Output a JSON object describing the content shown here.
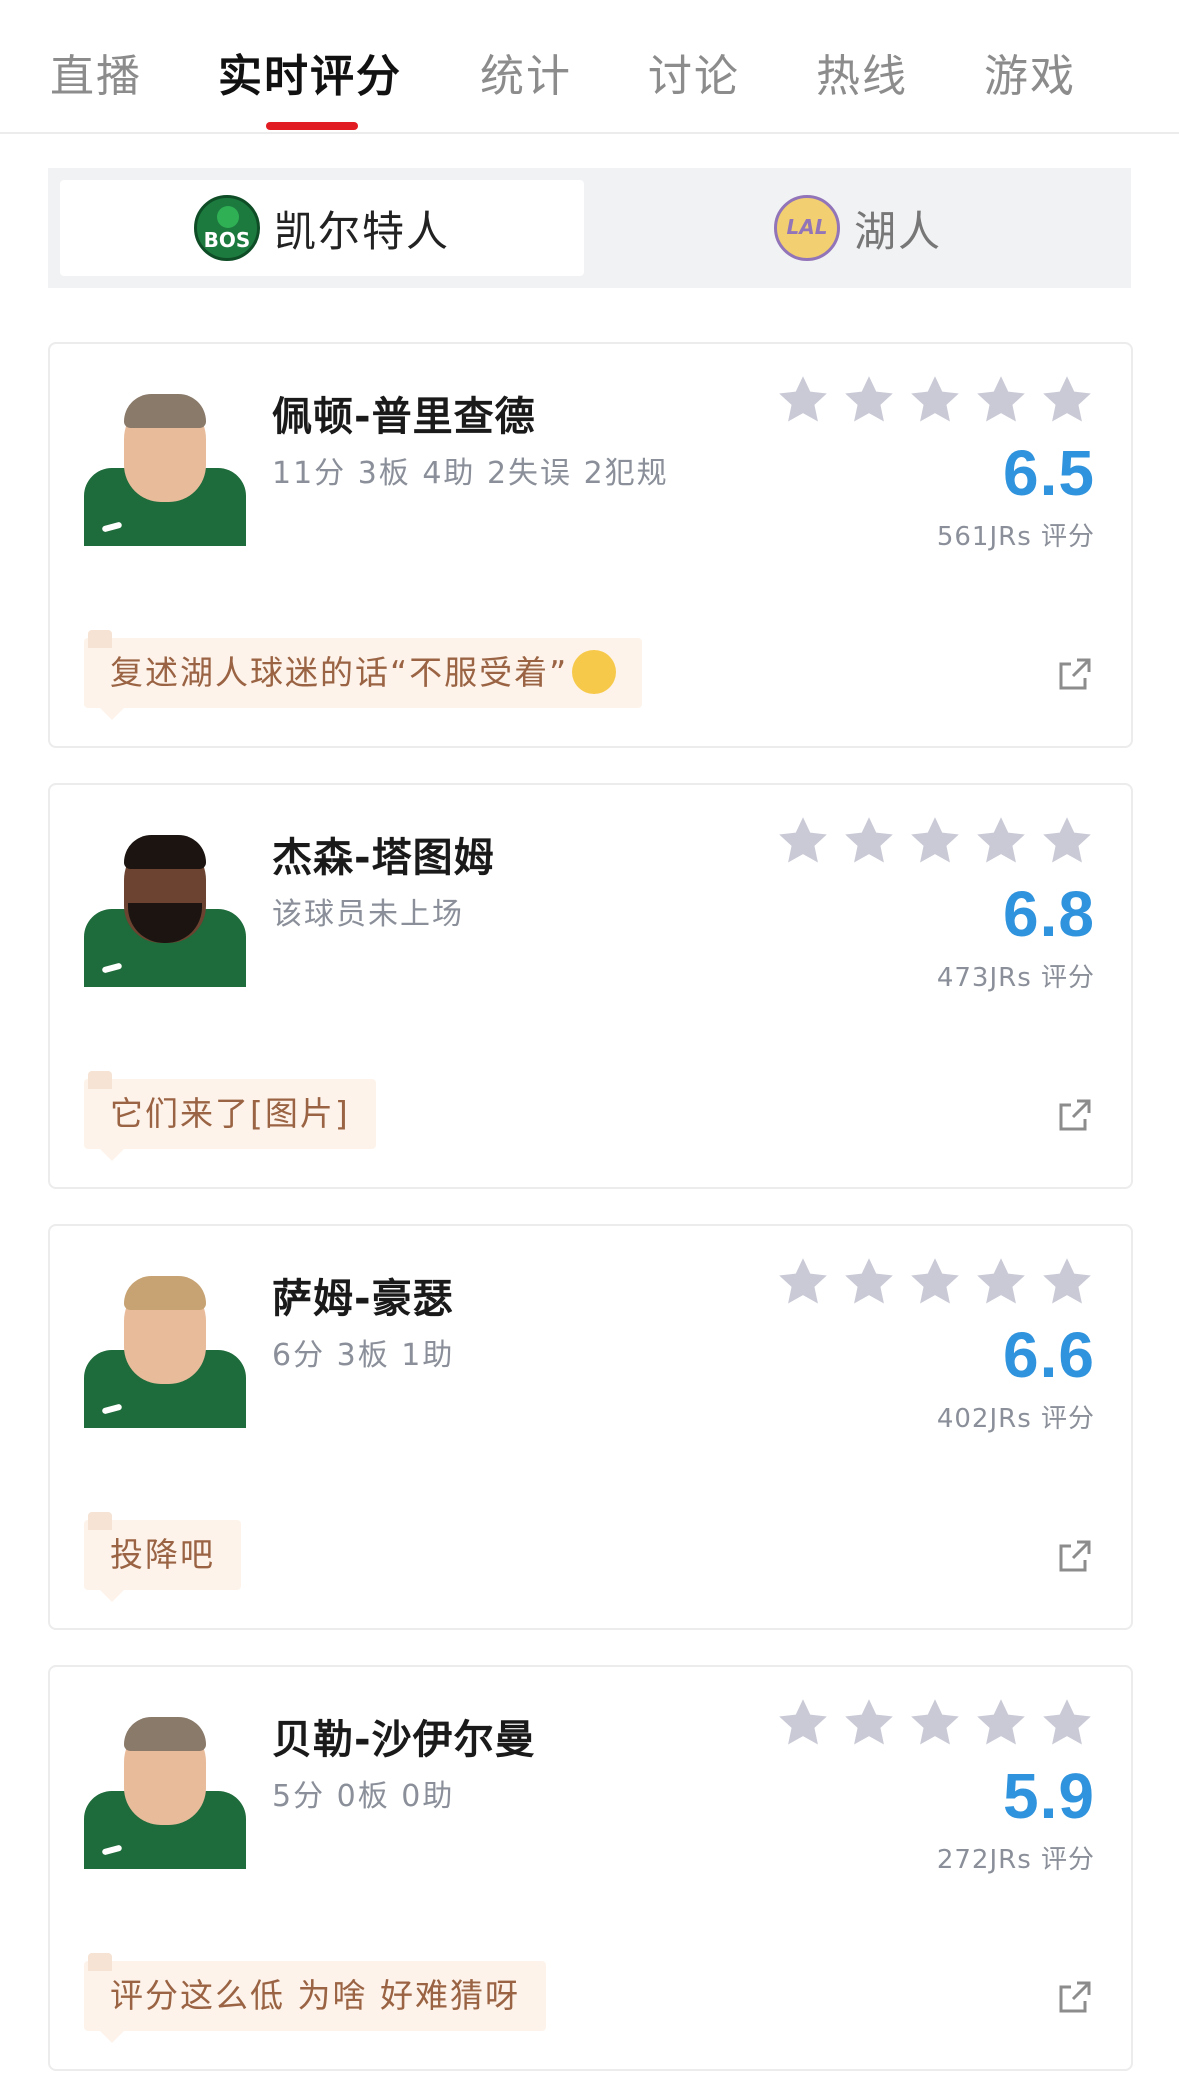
{
  "tabs": [
    {
      "label": "直播"
    },
    {
      "label": "实时评分"
    },
    {
      "label": "统计"
    },
    {
      "label": "讨论"
    },
    {
      "label": "热线"
    },
    {
      "label": "游戏"
    }
  ],
  "active_tab": "实时评分",
  "teams": {
    "home": {
      "name": "凯尔特人",
      "logo_text": "BOS",
      "logo_icon": "celtics-logo"
    },
    "away": {
      "name": "湖人",
      "logo_text": "LAL",
      "logo_icon": "lakers-logo"
    },
    "selected": "凯尔特人"
  },
  "players": [
    {
      "name": "佩顿-普里查德",
      "stats": "11分 3板 4助 2失误 2犯规",
      "score": "6.5",
      "rating_count": "561JRs 评分",
      "comment": "复述湖人球迷的话“不服受着”",
      "comment_emoji": "smirk-emoji"
    },
    {
      "name": "杰森-塔图姆",
      "stats": "该球员未上场",
      "score": "6.8",
      "rating_count": "473JRs 评分",
      "comment": "它们来了[图片]"
    },
    {
      "name": "萨姆-豪瑟",
      "stats": "6分 3板 1助",
      "score": "6.6",
      "rating_count": "402JRs 评分",
      "comment": "投降吧"
    },
    {
      "name": "贝勒-沙伊尔曼",
      "stats": "5分 0板 0助",
      "score": "5.9",
      "rating_count": "272JRs 评分",
      "comment": "评分这么低 为啥 好难猜呀"
    }
  ],
  "colors": {
    "accent_red": "#e21c23",
    "score_blue": "#2f93dd",
    "star_gray": "#c9cad6",
    "comment_bg": "#fdf3ea",
    "comment_text": "#9a6343"
  }
}
